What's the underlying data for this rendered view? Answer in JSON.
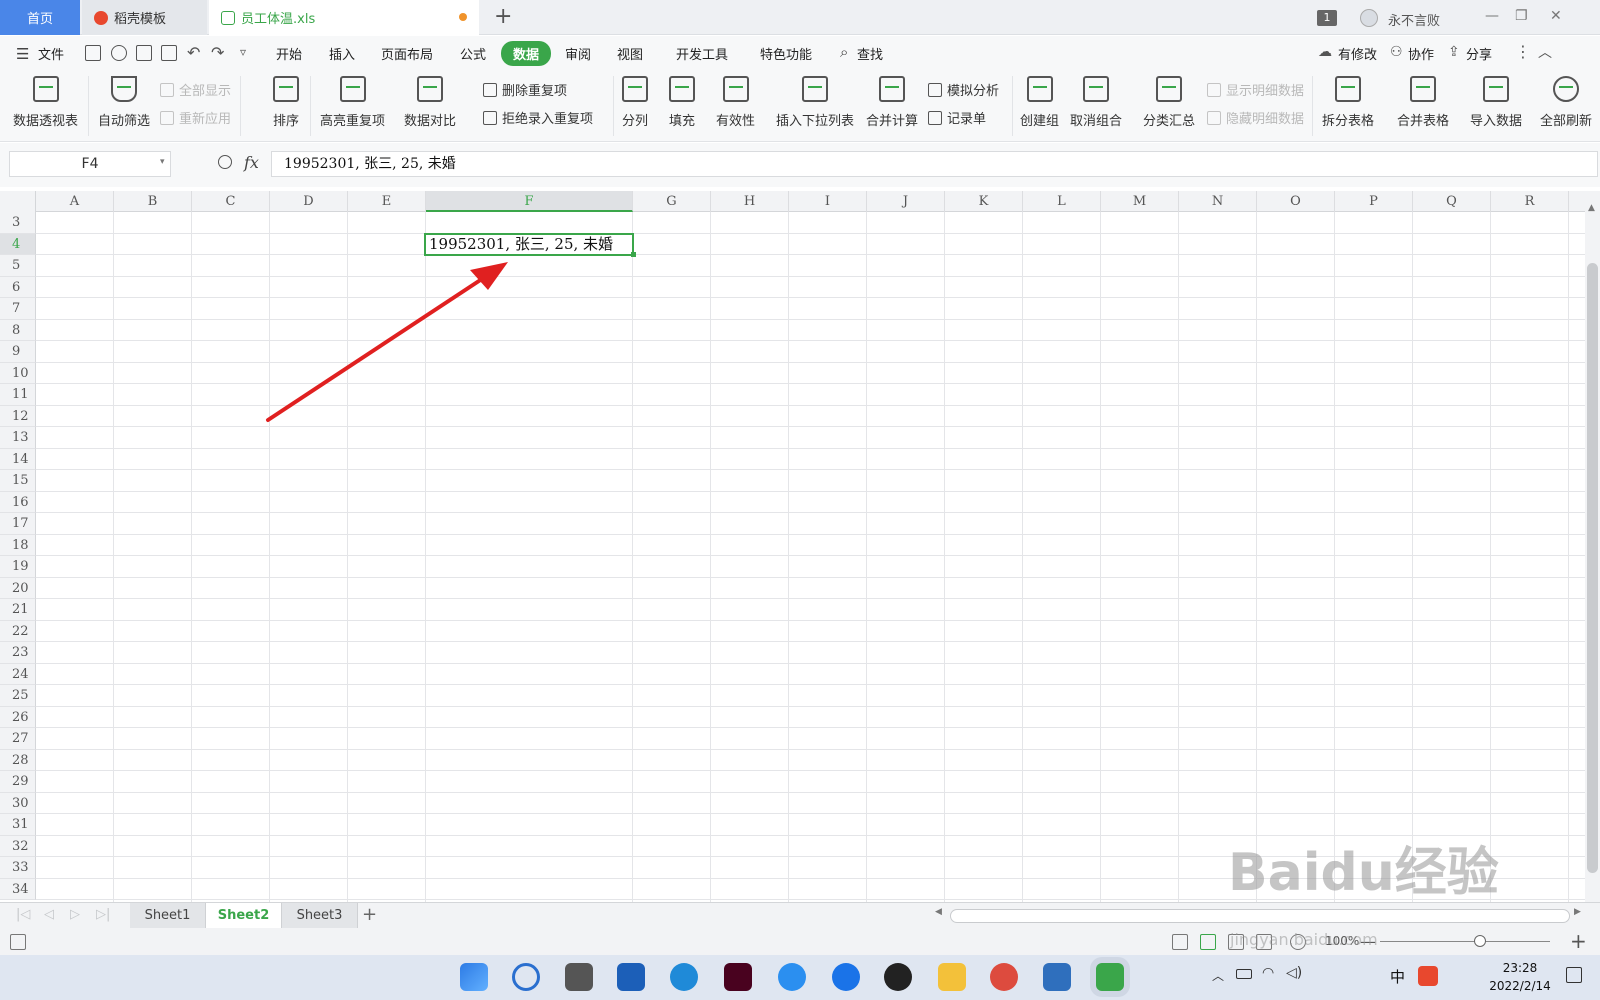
{
  "tabs": {
    "home": "首页",
    "template": "稻壳模板",
    "file": "员工体温.xls",
    "user": "永不言败",
    "badge": "1"
  },
  "menu": {
    "file": "文件",
    "items": [
      "开始",
      "插入",
      "页面布局",
      "公式",
      "数据",
      "审阅",
      "视图",
      "开发工具",
      "特色功能"
    ],
    "search": "查找",
    "modified": "有修改",
    "cowork": "协作",
    "share": "分享"
  },
  "ribbon": {
    "pivot": "数据透视表",
    "autofilter": "自动筛选",
    "show_all": "全部显示",
    "reapply": "重新应用",
    "sort": "排序",
    "highlight_dup": "高亮重复项",
    "compare": "数据对比",
    "remove_dup": "删除重复项",
    "reject_dup": "拒绝录入重复项",
    "split": "分列",
    "fill": "填充",
    "validity": "有效性",
    "dropdown": "插入下拉列表",
    "consolidate": "合并计算",
    "whatif": "模拟分析",
    "record": "记录单",
    "group": "创建组",
    "ungroup": "取消组合",
    "subtotal": "分类汇总",
    "show_detail": "显示明细数据",
    "hide_detail": "隐藏明细数据",
    "split_table": "拆分表格",
    "merge_table": "合并表格",
    "import": "导入数据",
    "refresh_all": "全部刷新"
  },
  "formula_bar": {
    "name_box": "F4",
    "fx": "fx",
    "content": "19952301, 张三, 25, 未婚"
  },
  "grid": {
    "columns": [
      "A",
      "B",
      "C",
      "D",
      "E",
      "F",
      "G",
      "H",
      "I",
      "J",
      "K",
      "L",
      "M",
      "N",
      "O",
      "P",
      "Q",
      "R"
    ],
    "rows": [
      "3",
      "4",
      "5",
      "6",
      "7",
      "8",
      "9",
      "10",
      "11",
      "12",
      "13",
      "14",
      "15",
      "16",
      "17",
      "18",
      "19",
      "20",
      "21",
      "22",
      "23",
      "24",
      "25",
      "26",
      "27",
      "28",
      "29",
      "30",
      "31",
      "32",
      "33",
      "34"
    ],
    "selected_column": "F",
    "selected_row": "4",
    "selected_cell_value": "19952301, 张三, 25, 未婚"
  },
  "sheets": [
    "Sheet1",
    "Sheet2",
    "Sheet3"
  ],
  "active_sheet": "Sheet2",
  "status": {
    "zoom": "100%"
  },
  "taskbar": {
    "ime": "中",
    "time": "23:28",
    "date": "2022/2/14"
  },
  "watermark": {
    "brand": "Baidu经验",
    "url": "jingyan.baidu.com"
  },
  "colors": {
    "accent": "#3aa64a",
    "home_tab": "#4a86e8",
    "arrow": "#e02020"
  }
}
